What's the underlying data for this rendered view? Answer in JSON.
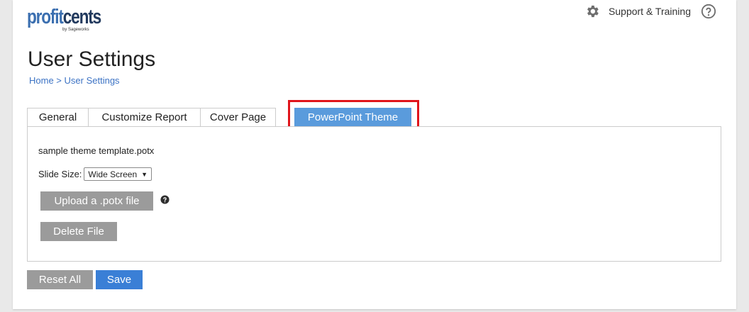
{
  "brand": {
    "logo_part1": "profit",
    "logo_part2": "cents",
    "logo_sub": "by Sageworks"
  },
  "header": {
    "support_label": "Support & Training",
    "gear_icon": "gear-icon",
    "help_icon": "question-circle-icon"
  },
  "page": {
    "title": "User Settings",
    "breadcrumb": {
      "home": "Home",
      "separator": " > ",
      "current": "User Settings"
    }
  },
  "tabs": [
    {
      "label": "General"
    },
    {
      "label": "Customize Report"
    },
    {
      "label": "Cover Page"
    },
    {
      "label": "PowerPoint Theme",
      "active": true
    }
  ],
  "panel": {
    "filename": "sample theme template.potx",
    "slide_size_label": "Slide Size:",
    "slide_size_value": "Wide Screen",
    "upload_label": "Upload a .potx file",
    "delete_label": "Delete File"
  },
  "footer": {
    "reset_label": "Reset All",
    "save_label": "Save"
  },
  "colors": {
    "accent": "#3a7fd6",
    "active_tab": "#5a9bdc",
    "highlight": "#e0151c",
    "gray_button": "#9b9b9b",
    "link": "#3b72c4"
  }
}
